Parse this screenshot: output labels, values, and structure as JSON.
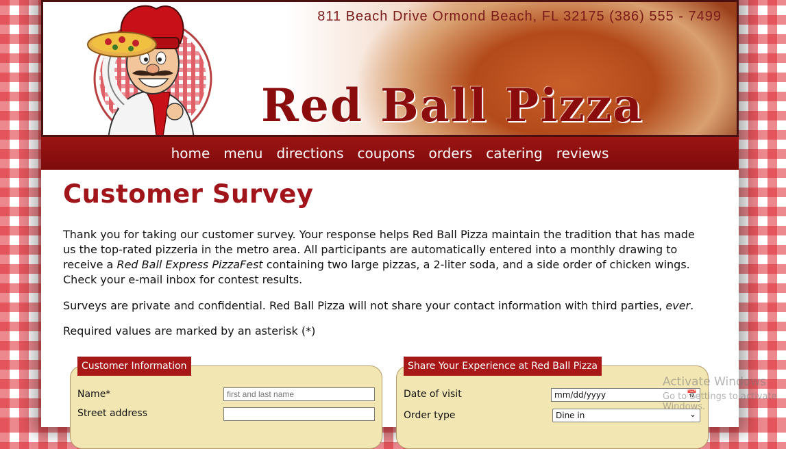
{
  "header": {
    "address": "811 Beach Drive  Ormond Beach, FL  32175   (386) 555 - 7499",
    "brand": "Red Ball Pizza"
  },
  "nav": [
    "home",
    "menu",
    "directions",
    "coupons",
    "orders",
    "catering",
    "reviews"
  ],
  "main": {
    "title": "Customer Survey",
    "intro_a": "Thank you for taking our customer survey. Your response helps Red Ball Pizza maintain the tradition that has made us the top-rated pizzeria in the metro area. All participants are automatically entered into a monthly drawing to receive a ",
    "intro_em": "Red Ball Express PizzaFest",
    "intro_b": " containing two large pizzas, a 2-liter soda, and a side order of chicken wings. Check your e-mail inbox for contest results.",
    "privacy_a": "Surveys are private and confidential. Red Ball Pizza will not share your contact information with third parties, ",
    "privacy_em": "ever",
    "privacy_b": ".",
    "required_note": "Required values are marked by an asterisk (*)"
  },
  "customer_info": {
    "legend": "Customer Information",
    "name_label": "Name*",
    "name_placeholder": "first and last name",
    "street_label": "Street address"
  },
  "experience": {
    "legend": "Share Your Experience at Red Ball Pizza",
    "date_label": "Date of visit",
    "date_placeholder": "mm/dd/yyyy",
    "order_label": "Order type",
    "order_value": "Dine in"
  },
  "watermark": {
    "line1": "Activate Windows",
    "line2": "Go to Settings to activate Windows."
  },
  "colors": {
    "brand_red": "#a0141a",
    "nav_red": "#8a0f0f",
    "fieldset_bg": "#f2e6b2"
  }
}
